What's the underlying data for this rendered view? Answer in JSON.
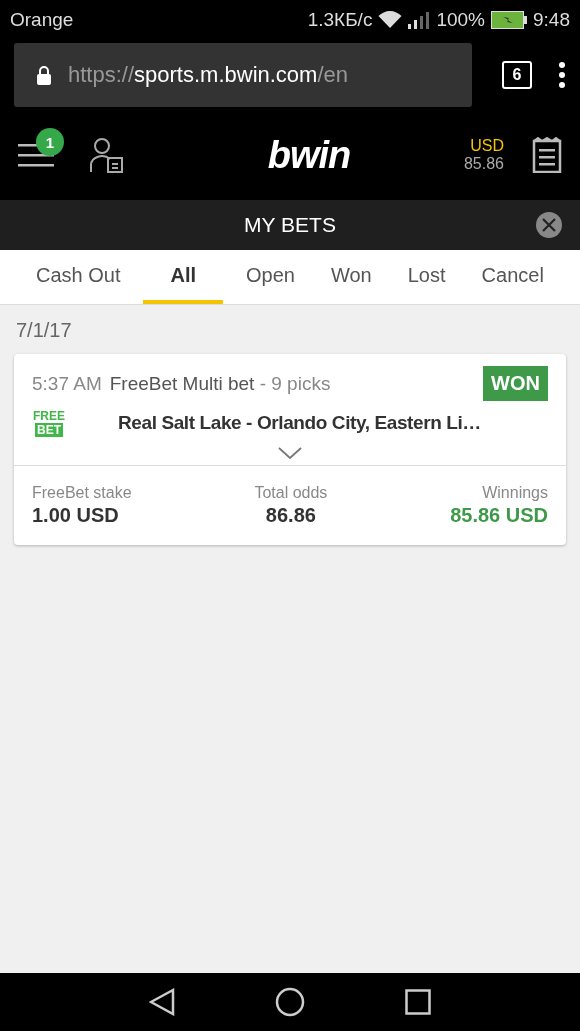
{
  "status_bar": {
    "carrier": "Orange",
    "speed": "1.3КБ/с",
    "battery": "100%",
    "time": "9:48"
  },
  "browser": {
    "url": {
      "scheme": "https://",
      "host": "sports.m.bwin.com",
      "path": "/en"
    },
    "tab_count": "6"
  },
  "header": {
    "menu_badge": "1",
    "logo": "bwin",
    "balance": {
      "currency": "USD",
      "amount": "85.86"
    }
  },
  "panel": {
    "title": "MY BETS"
  },
  "tabs": [
    {
      "label": "Cash Out",
      "selected": false
    },
    {
      "label": "All",
      "selected": true
    },
    {
      "label": "Open",
      "selected": false
    },
    {
      "label": "Won",
      "selected": false
    },
    {
      "label": "Lost",
      "selected": false
    },
    {
      "label": "Cancel",
      "selected": false
    }
  ],
  "date": "7/1/17",
  "bets": [
    {
      "time": "5:37 AM",
      "type": "FreeBet Multi bet",
      "picks": "- 9 picks",
      "status": "WON",
      "kind": "won",
      "freebet": {
        "top": "FREE",
        "bottom": "BET"
      },
      "event": "Real Salt Lake - Orlando City, Eastern Li…",
      "stats": [
        {
          "label": "FreeBet stake",
          "value": "1.00 USD",
          "kind": "plain"
        },
        {
          "label": "Total odds",
          "value": "86.86",
          "kind": "plain"
        },
        {
          "label": "Winnings",
          "value": "85.86 USD",
          "kind": "win"
        }
      ]
    }
  ]
}
